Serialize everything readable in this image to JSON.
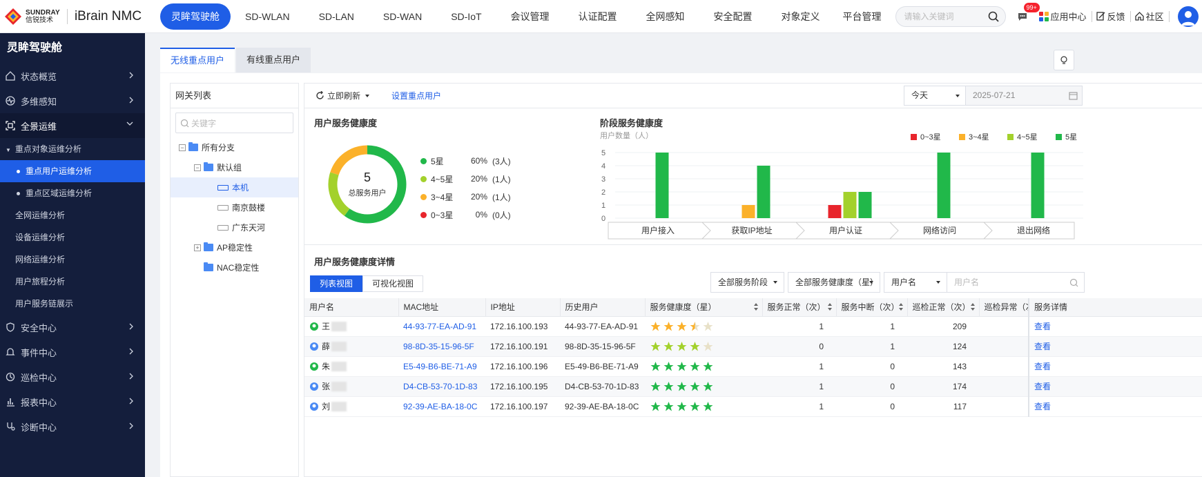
{
  "brand": {
    "logo_en": "SUNDRAY",
    "logo_cn": "信锐技术",
    "product": "iBrain NMC"
  },
  "nav": [
    "灵眸驾驶舱",
    "SD-WLAN",
    "SD-LAN",
    "SD-WAN",
    "SD-IoT",
    "会议管理",
    "认证配置",
    "全网感知",
    "安全配置",
    "对象定义",
    "平台管理"
  ],
  "top": {
    "search_placeholder": "请输入关键词",
    "badge": "99+",
    "app_center": "应用中心",
    "feedback": "反馈",
    "community": "社区"
  },
  "sidebar": {
    "title": "灵眸驾驶舱",
    "items": [
      "状态概览",
      "多维感知",
      "全景运维"
    ],
    "sub_group": "重点对象运维分析",
    "sub_items": [
      "重点用户运维分析",
      "重点区域运维分析"
    ],
    "sub_more": [
      "全网运维分析",
      "设备运维分析",
      "网络运维分析",
      "用户旅程分析",
      "用户服务链展示"
    ],
    "items_bottom": [
      "安全中心",
      "事件中心",
      "巡检中心",
      "报表中心",
      "诊断中心"
    ]
  },
  "tabs": [
    "无线重点用户",
    "有线重点用户"
  ],
  "gateway": {
    "title": "网关列表",
    "search_placeholder": "关键字",
    "tree": {
      "root": "所有分支",
      "default_group": "默认组",
      "devices": [
        "本机",
        "南京鼓楼",
        "广东天河"
      ],
      "groups": [
        "AP稳定性",
        "NAC稳定性"
      ]
    }
  },
  "toolbar": {
    "refresh": "立即刷新",
    "set_user": "设置重点用户",
    "period": "今天",
    "date": "2025-07-21"
  },
  "health": {
    "title": "用户服务健康度",
    "total": "5",
    "total_label": "总服务用户",
    "legend": [
      {
        "name": "5星",
        "pct": "60%",
        "count": "(3人)",
        "color": "#21b84a"
      },
      {
        "name": "4~5星",
        "pct": "20%",
        "count": "(1人)",
        "color": "#a3d12c"
      },
      {
        "name": "3~4星",
        "pct": "20%",
        "count": "(1人)",
        "color": "#fbb12a"
      },
      {
        "name": "0~3星",
        "pct": "0%",
        "count": "(0人)",
        "color": "#e8252c"
      }
    ],
    "values": [
      60,
      20,
      20,
      0
    ]
  },
  "chart_data": {
    "type": "bar",
    "title": "阶段服务健康度",
    "ylabel": "用户数量（人）",
    "ylim": [
      0,
      5
    ],
    "yticks": [
      "5",
      "4",
      "3",
      "2",
      "1",
      "0"
    ],
    "legend_position": "top-right",
    "categories": [
      "用户接入",
      "获取IP地址",
      "用户认证",
      "网络访问",
      "退出网络"
    ],
    "series": [
      {
        "name": "0~3星",
        "color": "#e8252c",
        "values": [
          0,
          0,
          1,
          0,
          0
        ]
      },
      {
        "name": "3~4星",
        "color": "#fbb12a",
        "values": [
          0,
          1,
          0,
          0,
          0
        ]
      },
      {
        "name": "4~5星",
        "color": "#a3d12c",
        "values": [
          0,
          0,
          2,
          0,
          0
        ]
      },
      {
        "name": "5星",
        "color": "#21b84a",
        "values": [
          5,
          4,
          2,
          5,
          5
        ]
      }
    ]
  },
  "detail": {
    "title": "用户服务健康度详情",
    "views": [
      "列表视图",
      "可视化视图"
    ],
    "filters": {
      "stage": "全部服务阶段",
      "health": "全部服务健康度（星）",
      "field": "用户名",
      "input_placeholder": "用户名"
    },
    "columns": [
      "用户名",
      "MAC地址",
      "IP地址",
      "历史用户",
      "服务健康度（星）",
      "服务正常（次）",
      "服务中断（次）",
      "巡检正常（次）",
      "巡检异常（次）",
      "服务详情"
    ],
    "rows": [
      {
        "name": "王",
        "mac": "44-93-77-EA-AD-91",
        "ip": "172.16.100.193",
        "hist": "44-93-77-EA-AD-91",
        "stars": 3.5,
        "ok": "1",
        "broken": "1",
        "insp": "209",
        "act": "查看"
      },
      {
        "name": "薛",
        "mac": "98-8D-35-15-96-5F",
        "ip": "172.16.100.191",
        "hist": "98-8D-35-15-96-5F",
        "stars": 4,
        "ok": "0",
        "broken": "1",
        "insp": "124",
        "act": "查看"
      },
      {
        "name": "朱",
        "mac": "E5-49-B6-BE-71-A9",
        "ip": "172.16.100.196",
        "hist": "E5-49-B6-BE-71-A9",
        "stars": 5,
        "ok": "1",
        "broken": "0",
        "insp": "143",
        "act": "查看"
      },
      {
        "name": "张",
        "mac": "D4-CB-53-70-1D-83",
        "ip": "172.16.100.195",
        "hist": "D4-CB-53-70-1D-83",
        "stars": 5,
        "ok": "1",
        "broken": "0",
        "insp": "174",
        "act": "查看"
      },
      {
        "name": "刘",
        "mac": "92-39-AE-BA-18-0C",
        "ip": "172.16.100.197",
        "hist": "92-39-AE-BA-18-0C",
        "stars": 5,
        "ok": "1",
        "broken": "0",
        "insp": "117",
        "act": "查看"
      }
    ]
  }
}
